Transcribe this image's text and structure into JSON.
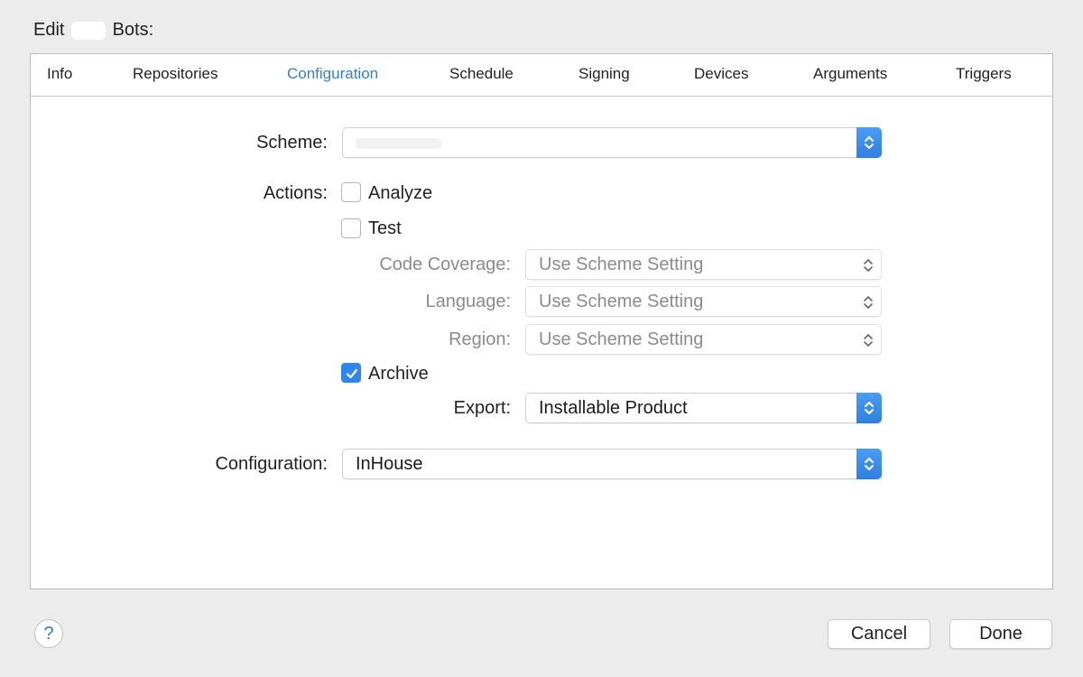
{
  "window": {
    "title_prefix": "Edit",
    "title_suffix": "Bots:"
  },
  "tabs": [
    {
      "label": "Info"
    },
    {
      "label": "Repositories"
    },
    {
      "label": "Configuration",
      "active": true
    },
    {
      "label": "Schedule"
    },
    {
      "label": "Signing"
    },
    {
      "label": "Devices"
    },
    {
      "label": "Arguments"
    },
    {
      "label": "Triggers"
    }
  ],
  "form": {
    "scheme": {
      "label": "Scheme:",
      "value": ""
    },
    "actions": {
      "label": "Actions:",
      "analyze": {
        "label": "Analyze",
        "checked": false
      },
      "test": {
        "label": "Test",
        "checked": false
      },
      "code_coverage": {
        "label": "Code Coverage:",
        "value": "Use Scheme Setting"
      },
      "language": {
        "label": "Language:",
        "value": "Use Scheme Setting"
      },
      "region": {
        "label": "Region:",
        "value": "Use Scheme Setting"
      },
      "archive": {
        "label": "Archive",
        "checked": true
      },
      "export": {
        "label": "Export:",
        "value": "Installable Product"
      }
    },
    "configuration": {
      "label": "Configuration:",
      "value": "InHouse"
    }
  },
  "footer": {
    "help_label": "?",
    "cancel_label": "Cancel",
    "done_label": "Done"
  },
  "colors": {
    "accent": "#2f7fd6",
    "checkbox_checked": "#2f86ec",
    "background": "#ececec",
    "panel": "#ffffff"
  }
}
